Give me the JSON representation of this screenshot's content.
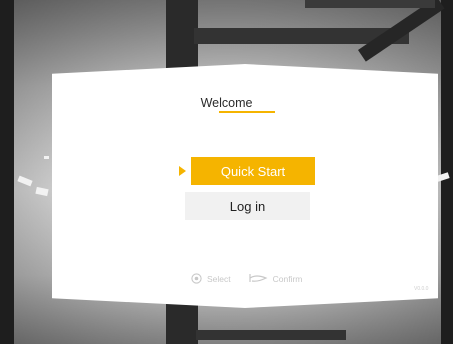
{
  "panel": {
    "title": "Welcome"
  },
  "menu": {
    "items": [
      {
        "label": "Quick Start",
        "selected": true
      },
      {
        "label": "Log in",
        "selected": false
      }
    ]
  },
  "hints": {
    "select_label": "Select",
    "confirm_label": "Confirm"
  },
  "version": "V0.0.0",
  "colors": {
    "accent": "#f5b400",
    "panel": "#ffffff",
    "secondary_button": "#f1f1f1"
  },
  "icons": {
    "select": "trackpad-circle-icon",
    "confirm": "controller-trigger-icon"
  }
}
